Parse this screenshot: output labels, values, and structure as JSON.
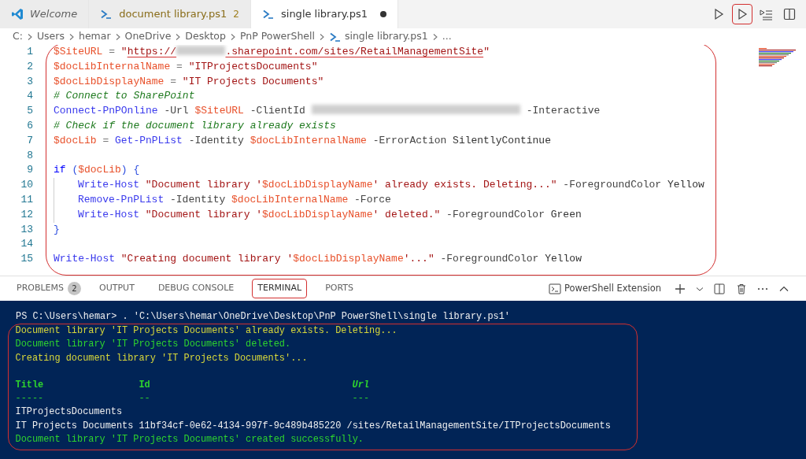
{
  "tabs": [
    {
      "label": "Welcome",
      "kind": "welcome",
      "selected": false,
      "preview": true
    },
    {
      "label": "document library.ps1",
      "kind": "script",
      "selected": false,
      "preview": false,
      "badge": "2"
    },
    {
      "label": "single library.ps1",
      "kind": "script",
      "selected": true,
      "preview": false,
      "dirty": true
    }
  ],
  "editor_actions": [
    {
      "kind": "run",
      "highlighted": false
    },
    {
      "kind": "run",
      "highlighted": true
    },
    {
      "kind": "run-selection",
      "highlighted": false
    },
    {
      "kind": "split",
      "highlighted": false
    }
  ],
  "breadcrumb": [
    {
      "label": "C:"
    },
    {
      "label": "Users"
    },
    {
      "label": "hemar"
    },
    {
      "label": "OneDrive"
    },
    {
      "label": "Desktop"
    },
    {
      "label": "PnP PowerShell"
    },
    {
      "label": "single library.ps1",
      "kind": "script"
    },
    {
      "label": "..."
    }
  ],
  "editor": {
    "highlighted": true,
    "lines": [
      {
        "number": "1",
        "tokens": [
          {
            "kind": "var",
            "text": "$SiteURL"
          },
          {
            "kind": "op",
            "text": " = "
          },
          {
            "kind": "string",
            "text": "\""
          },
          {
            "kind": "link",
            "text": "https://"
          },
          {
            "kind": "redacted-short"
          },
          {
            "kind": "link",
            "text": ".sharepoint.com/sites/RetailManagementSite"
          },
          {
            "kind": "string",
            "text": "\""
          }
        ]
      },
      {
        "number": "2",
        "tokens": [
          {
            "kind": "var",
            "text": "$docLibInternalName"
          },
          {
            "kind": "op",
            "text": " = "
          },
          {
            "kind": "string",
            "text": "\"ITProjectsDocuments\""
          }
        ]
      },
      {
        "number": "3",
        "tokens": [
          {
            "kind": "var",
            "text": "$docLibDisplayName"
          },
          {
            "kind": "op",
            "text": " = "
          },
          {
            "kind": "string",
            "text": "\"IT Projects Documents\""
          }
        ]
      },
      {
        "number": "4",
        "tokens": [
          {
            "kind": "comment",
            "text": "# Connect to SharePoint"
          }
        ]
      },
      {
        "number": "5",
        "tokens": [
          {
            "kind": "cmdlet",
            "text": "Connect-PnPOnline"
          },
          {
            "kind": "param",
            "text": " -Url"
          },
          {
            "kind": "var",
            "text": " $SiteURL"
          },
          {
            "kind": "param",
            "text": " -ClientId "
          },
          {
            "kind": "redacted-long"
          },
          {
            "kind": "param",
            "text": " -Interactive"
          }
        ]
      },
      {
        "number": "6",
        "tokens": [
          {
            "kind": "comment",
            "text": "# Check if the document library already exists"
          }
        ]
      },
      {
        "number": "7",
        "tokens": [
          {
            "kind": "var",
            "text": "$docLib"
          },
          {
            "kind": "op",
            "text": " = "
          },
          {
            "kind": "cmdlet",
            "text": "Get-PnPList"
          },
          {
            "kind": "param",
            "text": " -Identity"
          },
          {
            "kind": "var",
            "text": " $docLibInternalName"
          },
          {
            "kind": "param",
            "text": " -ErrorAction"
          },
          {
            "kind": "plain",
            "text": " SilentlyContinue"
          }
        ]
      },
      {
        "number": "8"
      },
      {
        "number": "9",
        "tokens": [
          {
            "kind": "keyword",
            "text": "if"
          },
          {
            "kind": "punct",
            "text": " ("
          },
          {
            "kind": "var",
            "text": "$docLib"
          },
          {
            "kind": "punct",
            "text": ") {"
          }
        ]
      },
      {
        "number": "10",
        "indent": true,
        "tokens": [
          {
            "kind": "cmdlet",
            "text": "Write-Host"
          },
          {
            "kind": "string",
            "text": " \"Document library '"
          },
          {
            "kind": "var",
            "text": "$docLibDisplayName"
          },
          {
            "kind": "string",
            "text": "' already exists. Deleting...\""
          },
          {
            "kind": "param",
            "text": " -ForegroundColor"
          },
          {
            "kind": "plain",
            "text": " Yellow"
          }
        ]
      },
      {
        "number": "11",
        "indent": true,
        "tokens": [
          {
            "kind": "cmdlet",
            "text": "Remove-PnPList"
          },
          {
            "kind": "param",
            "text": " -Identity"
          },
          {
            "kind": "var",
            "text": " $docLibInternalName"
          },
          {
            "kind": "param",
            "text": " -Force"
          }
        ]
      },
      {
        "number": "12",
        "indent": true,
        "tokens": [
          {
            "kind": "cmdlet",
            "text": "Write-Host"
          },
          {
            "kind": "string",
            "text": " \"Document library '"
          },
          {
            "kind": "var",
            "text": "$docLibDisplayName"
          },
          {
            "kind": "string",
            "text": "' deleted.\""
          },
          {
            "kind": "param",
            "text": " -ForegroundColor"
          },
          {
            "kind": "plain",
            "text": " Green"
          }
        ]
      },
      {
        "number": "13",
        "tokens": [
          {
            "kind": "punct",
            "text": "}"
          }
        ]
      },
      {
        "number": "14"
      },
      {
        "number": "15",
        "tokens": [
          {
            "kind": "cmdlet",
            "text": "Write-Host"
          },
          {
            "kind": "string",
            "text": " \"Creating document library '"
          },
          {
            "kind": "var",
            "text": "$docLibDisplayName"
          },
          {
            "kind": "string",
            "text": "'...\""
          },
          {
            "kind": "param",
            "text": " -ForegroundColor"
          },
          {
            "kind": "plain",
            "text": " Yellow"
          }
        ]
      }
    ]
  },
  "panel_tabs": [
    {
      "label": "PROBLEMS",
      "badge": "2",
      "selected": false,
      "highlighted": false
    },
    {
      "label": "OUTPUT",
      "selected": false,
      "highlighted": false
    },
    {
      "label": "DEBUG CONSOLE",
      "selected": false,
      "highlighted": false
    },
    {
      "label": "TERMINAL",
      "selected": true,
      "highlighted": true
    },
    {
      "label": "PORTS",
      "selected": false,
      "highlighted": false
    }
  ],
  "terminal_name": "PowerShell Extension",
  "panel_actions": [
    {
      "kind": "add"
    },
    {
      "kind": "dropdown"
    },
    {
      "kind": "split"
    },
    {
      "kind": "trash"
    },
    {
      "kind": "more"
    },
    {
      "kind": "collapse"
    }
  ],
  "terminal": {
    "prompt": "PS C:\\Users\\hemar> . 'C:\\Users\\hemar\\OneDrive\\Desktop\\PnP PowerShell\\single library.ps1'",
    "highlighted": true,
    "lines": [
      {
        "kind": "warning",
        "text": "Document library 'IT Projects Documents' already exists. Deleting..."
      },
      {
        "kind": "success",
        "text": "Document library 'IT Projects Documents' deleted."
      },
      {
        "kind": "warning",
        "text": "Creating document library 'IT Projects Documents'..."
      },
      {
        "kind": "blank"
      },
      {
        "kind": "table-header",
        "cells": [
          "Title",
          "Id",
          "Url"
        ]
      },
      {
        "kind": "table-rule",
        "cells": [
          "-----",
          "--",
          "---"
        ]
      },
      {
        "kind": "output",
        "text": "ITProjectsDocuments"
      },
      {
        "kind": "output",
        "text": "IT Projects Documents 11bf34cf-0e62-4134-997f-9c489b485220 /sites/RetailManagementSite/ITProjectsDocuments"
      },
      {
        "kind": "success",
        "text": "Document library 'IT Projects Documents' created successfully."
      }
    ]
  }
}
